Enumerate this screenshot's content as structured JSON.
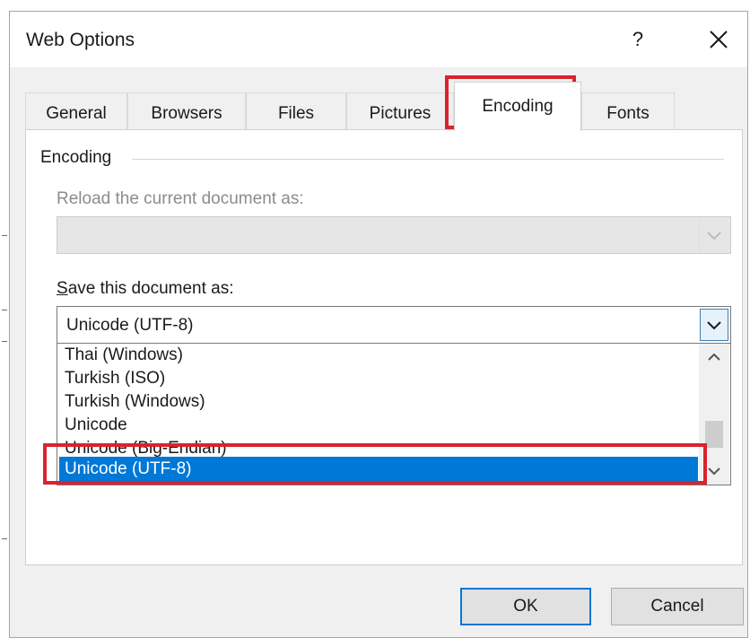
{
  "dialog": {
    "title": "Web Options",
    "help_label": "?"
  },
  "tabs": [
    {
      "label": "General"
    },
    {
      "label": "Browsers"
    },
    {
      "label": "Files"
    },
    {
      "label": "Pictures"
    },
    {
      "label": "Encoding",
      "active": true
    },
    {
      "label": "Fonts"
    }
  ],
  "encoding": {
    "group_label": "Encoding",
    "reload_label": "Reload the current document as:",
    "reload_value": "",
    "save_label_mnemonic": "S",
    "save_label_rest": "ave this document as:",
    "save_value": "Unicode (UTF-8)",
    "options": [
      "Thai (Windows)",
      "Turkish (ISO)",
      "Turkish (Windows)",
      "Unicode",
      "Unicode (Big-Endian)",
      "Unicode (UTF-8)"
    ],
    "selected_option": "Unicode (UTF-8)"
  },
  "buttons": {
    "ok_label": "OK",
    "cancel_label": "Cancel"
  },
  "colors": {
    "highlight": "#d9232e",
    "selection": "#0078d7",
    "default_button_border": "#0078d7"
  },
  "icons": {
    "close": "close-icon",
    "dropdown": "chevron-down-icon",
    "scroll_up": "chevron-up-icon",
    "scroll_down": "chevron-down-icon"
  }
}
